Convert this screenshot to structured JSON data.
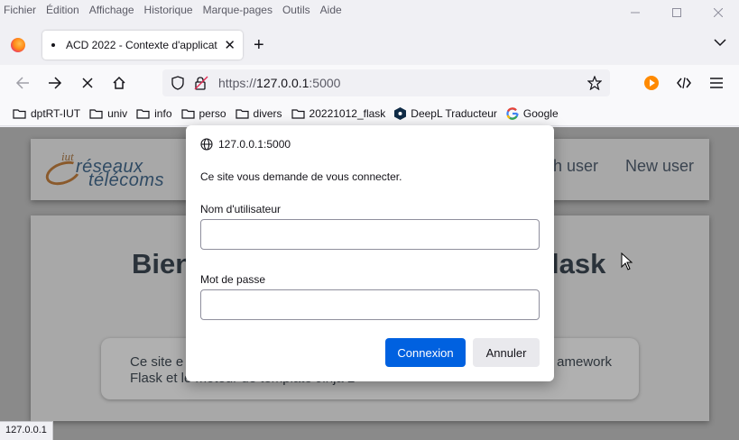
{
  "menubar": {
    "items": [
      "Fichier",
      "Édition",
      "Affichage",
      "Historique",
      "Marque-pages",
      "Outils",
      "Aide"
    ]
  },
  "tab": {
    "title": "ACD 2022 - Contexte d'applicat",
    "close_glyph": "✕"
  },
  "newtab_glyph": "+",
  "urlbar": {
    "scheme": "https://",
    "host": "127.0.0.1",
    "port": ":5000"
  },
  "bookmarks": [
    {
      "label": "dptRT-IUT",
      "icon": "folder-icon"
    },
    {
      "label": "univ",
      "icon": "folder-icon"
    },
    {
      "label": "info",
      "icon": "folder-icon"
    },
    {
      "label": "perso",
      "icon": "folder-icon"
    },
    {
      "label": "divers",
      "icon": "folder-icon"
    },
    {
      "label": "20221012_flask",
      "icon": "folder-icon"
    },
    {
      "label": "DeepL Traducteur",
      "icon": "deepl-icon"
    },
    {
      "label": "Google",
      "icon": "google-icon"
    }
  ],
  "page": {
    "logo": {
      "iut": "iut",
      "line1": "réseaux",
      "line2": "télécoms"
    },
    "nav": {
      "search": "ch user",
      "new": "New user"
    },
    "heading_left": "Bien",
    "heading_right": "lask",
    "intro_line1": "Ce site e",
    "intro_tail": "amework",
    "intro_line2": "Flask et le moteur de template Jinja 2"
  },
  "status": {
    "text": "127.0.0.1"
  },
  "dialog": {
    "origin": "127.0.0.1:5000",
    "message": "Ce site vous demande de vous connecter.",
    "username_label": "Nom d'utilisateur",
    "username_value": "",
    "password_label": "Mot de passe",
    "password_value": "",
    "ok_label": "Connexion",
    "cancel_label": "Annuler"
  },
  "colors": {
    "primary_button": "#0061e0",
    "page_overlay": "#8a8a8a"
  }
}
